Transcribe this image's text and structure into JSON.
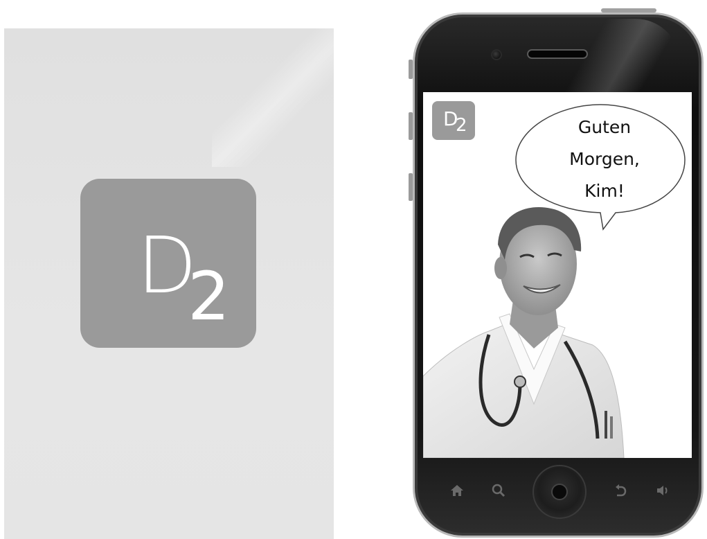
{
  "splash": {
    "logo_letter": "D",
    "logo_number": "2"
  },
  "phone": {
    "app_logo_letter": "D",
    "app_logo_number": "2",
    "speech_bubble": {
      "line1": "Guten",
      "line2": "Morgen,",
      "line3": "Kim!"
    },
    "navbar": {
      "icons": [
        "home-icon",
        "search-icon",
        "home-button",
        "back-icon",
        "volume-icon"
      ]
    }
  },
  "colors": {
    "logo_gray": "#9a9a9a",
    "splash_bg": "#e3e3e3",
    "phone_body": "#111111"
  }
}
